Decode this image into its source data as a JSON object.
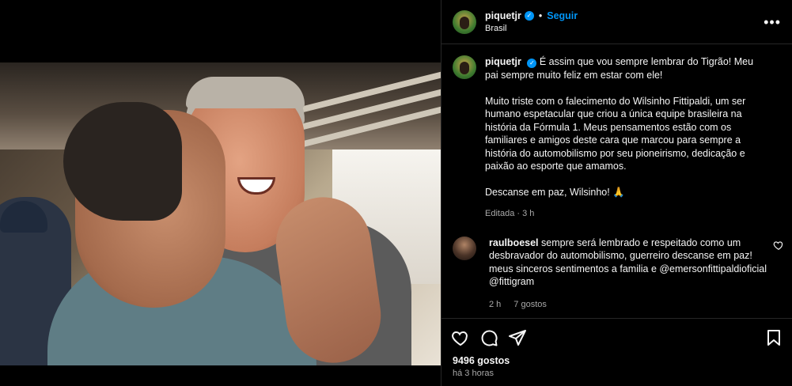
{
  "post": {
    "author": {
      "username": "piquetjr",
      "verified_glyph": "✓",
      "follow_label": "Seguir",
      "location": "Brasil",
      "separator": "•"
    },
    "more_icon": "more-horizontal-icon",
    "caption": {
      "username": "piquetjr",
      "paragraphs": [
        "É assim que vou sempre lembrar do Tigrão! Meu pai sempre muito feliz em estar com ele!",
        "Muito triste com o falecimento do Wilsinho Fittipaldi, um ser humano espetacular que criou a única equipe brasileira na história da Fórmula 1. Meus pensamentos estão com os familiares e amigos deste cara que marcou para sempre a história do automobilismo por seu pioneirismo, dedicação e paixão ao esporte que amamos.",
        "Descanse em paz, Wilsinho! 🙏"
      ],
      "meta": "Editada · 3 h"
    },
    "comments": [
      {
        "username": "raulboesel",
        "text": "sempre será lembrado e respeitado como um desbravador do automobilismo, guerreiro descanse em paz! meus sinceros sentimentos a familia e @emersonfittipaldioficial @fittigram",
        "time": "2 h",
        "likes": "7 gostos"
      }
    ],
    "likes_label": "9496 gostos",
    "timestamp": "há 3 horas",
    "icons": {
      "like": "heart-icon",
      "comment": "comment-icon",
      "share": "share-icon",
      "save": "bookmark-icon",
      "comment_like": "heart-icon"
    },
    "colors": {
      "background": "#000000",
      "link": "#0095f6",
      "muted": "#a8a8a8",
      "divider": "#262626"
    }
  }
}
